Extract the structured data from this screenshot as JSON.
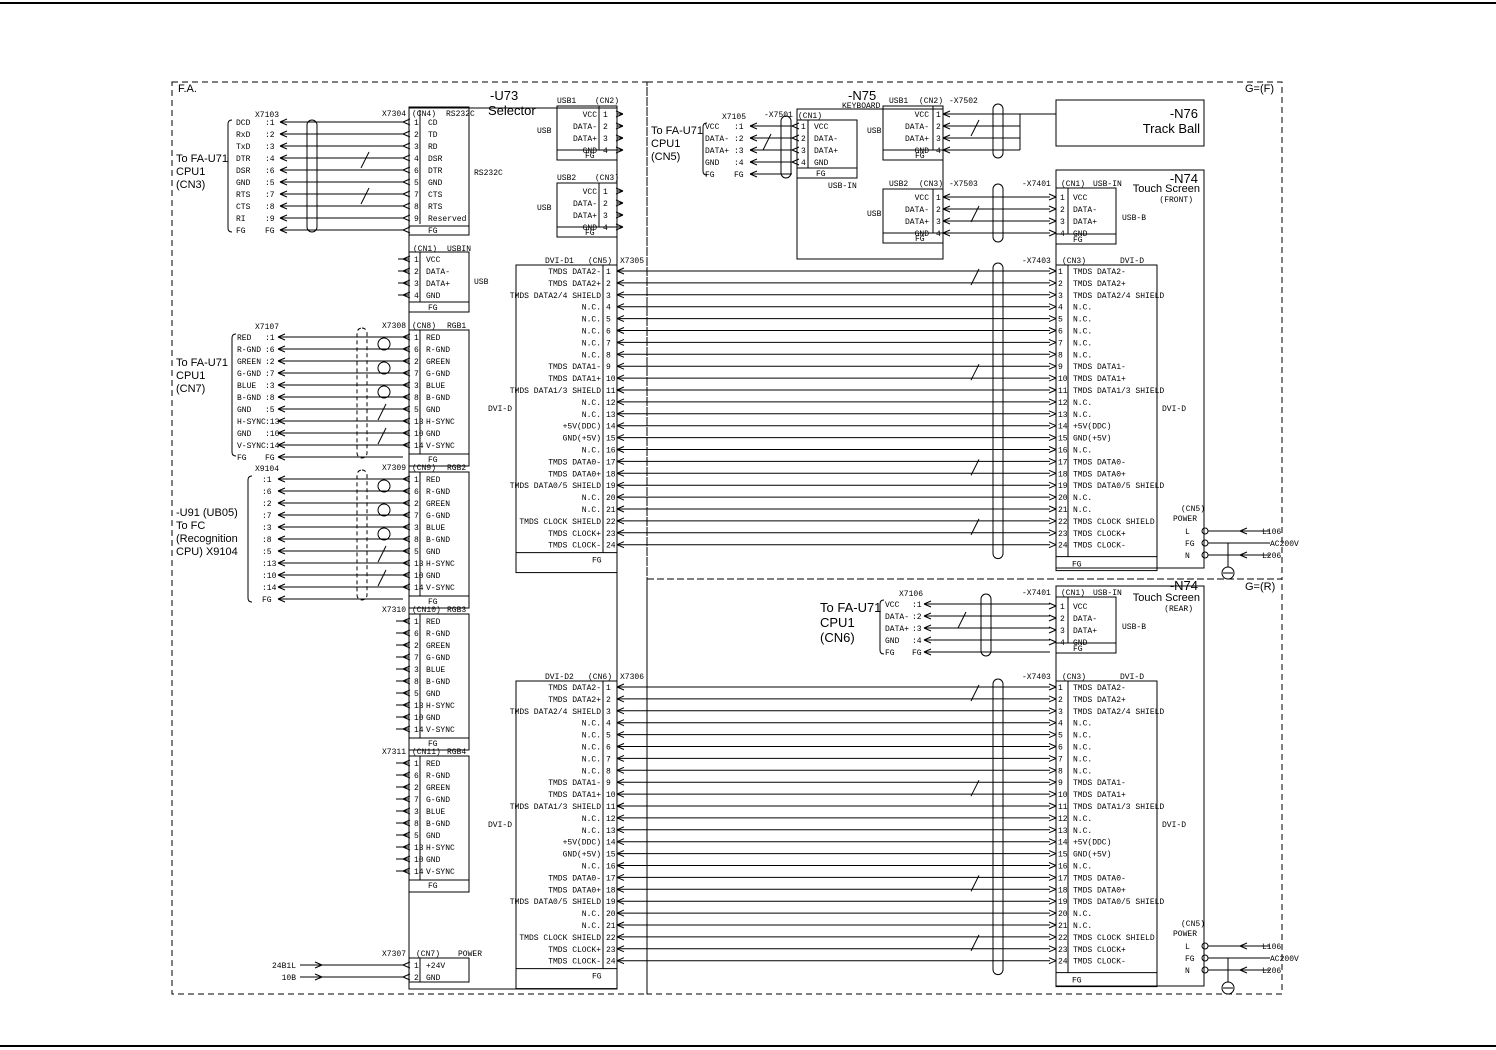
{
  "frames": {
    "fa_label": "F.A.",
    "g_f_label": "G=(F)",
    "g_r_label": "G=(R)"
  },
  "selector": {
    "ref": "-U73",
    "name": "Selector"
  },
  "keyboard": {
    "ref": "-N75",
    "name": "KEYBOARD",
    "usb_in": "USB-IN"
  },
  "trackball": {
    "ref": "-N76",
    "name": "Track Ball"
  },
  "touch_front": {
    "ref": "-N74",
    "name": "Touch Screen",
    "sub": "(FRONT)"
  },
  "touch_rear": {
    "ref": "-N74",
    "name": "Touch Screen",
    "sub": "(REAR)"
  },
  "rs232": {
    "source": [
      "To FA-U71",
      "CPU1",
      "(CN3)"
    ],
    "x_left": "X7103",
    "x_right": "X7304",
    "cn": "(CN4)",
    "cn_type": "RS232C",
    "side_label": "RS232C",
    "left_pins": [
      {
        "sig": "DCD",
        "n": ":1"
      },
      {
        "sig": "RxD",
        "n": ":2"
      },
      {
        "sig": "TxD",
        "n": ":3"
      },
      {
        "sig": "DTR",
        "n": ":4"
      },
      {
        "sig": "DSR",
        "n": ":6"
      },
      {
        "sig": "GND",
        "n": ":5"
      },
      {
        "sig": "RTS",
        "n": ":7"
      },
      {
        "sig": "CTS",
        "n": ":8"
      },
      {
        "sig": "RI",
        "n": ":9"
      },
      {
        "sig": "FG",
        "n": "FG"
      }
    ],
    "right_pins": [
      {
        "n": "1",
        "sig": "CD"
      },
      {
        "n": "2",
        "sig": "TD"
      },
      {
        "n": "3",
        "sig": "RD"
      },
      {
        "n": "4",
        "sig": "DSR"
      },
      {
        "n": "6",
        "sig": "DTR"
      },
      {
        "n": "5",
        "sig": "GND"
      },
      {
        "n": "7",
        "sig": "CTS"
      },
      {
        "n": "8",
        "sig": "RTS"
      },
      {
        "n": "9",
        "sig": "Reserved"
      }
    ],
    "fg": "FG"
  },
  "usb1": {
    "title": "USB1",
    "cn": "(CN2)",
    "side": "USB",
    "pins": [
      {
        "sig": "VCC",
        "n": "1"
      },
      {
        "sig": "DATA-",
        "n": "2"
      },
      {
        "sig": "DATA+",
        "n": "3"
      },
      {
        "sig": "GND",
        "n": "4"
      }
    ],
    "fg": "FG"
  },
  "usb2": {
    "title": "USB2",
    "cn": "(CN3)",
    "side": "USB",
    "pins": [
      {
        "sig": "VCC",
        "n": "1"
      },
      {
        "sig": "DATA-",
        "n": "2"
      },
      {
        "sig": "DATA+",
        "n": "3"
      },
      {
        "sig": "GND",
        "n": "4"
      }
    ],
    "fg": "FG"
  },
  "usbin": {
    "cn": "(CN1)",
    "title": "USBIN",
    "side": "USB",
    "pins": [
      {
        "n": "1",
        "sig": "VCC"
      },
      {
        "n": "2",
        "sig": "DATA-"
      },
      {
        "n": "3",
        "sig": "DATA+"
      },
      {
        "n": "4",
        "sig": "GND"
      }
    ],
    "fg": "FG"
  },
  "rgb1": {
    "source": [
      "To FA-U71",
      "CPU1",
      "(CN7)"
    ],
    "x_left": "X7107",
    "x_right": "X7308",
    "cn": "(CN8)",
    "title": "RGB1",
    "left_pins": [
      {
        "sig": "RED",
        "n": ":1"
      },
      {
        "sig": "R-GND",
        "n": ":6"
      },
      {
        "sig": "GREEN",
        "n": ":2"
      },
      {
        "sig": "G-GND",
        "n": ":7"
      },
      {
        "sig": "BLUE",
        "n": ":3"
      },
      {
        "sig": "B-GND",
        "n": ":8"
      },
      {
        "sig": "GND",
        "n": ":5"
      },
      {
        "sig": "H-SYNC",
        "n": ":13"
      },
      {
        "sig": "GND",
        "n": ":10"
      },
      {
        "sig": "V-SYNC",
        "n": ":14"
      },
      {
        "sig": "FG",
        "n": "FG"
      }
    ],
    "fg": "FG"
  },
  "rgb2": {
    "source": [
      "-U91 (UB05)",
      "To FC",
      "(Recognition",
      "CPU) X9104"
    ],
    "x_left": "X9104",
    "x_right": "X7309",
    "cn": "(CN9)",
    "title": "RGB2",
    "left_pins": [
      ":1",
      ":6",
      ":2",
      ":7",
      ":3",
      ":8",
      ":5",
      ":13",
      ":10",
      ":14",
      "FG"
    ],
    "fg": "FG"
  },
  "rgb3": {
    "x_right": "X7310",
    "cn": "(CN10)",
    "title": "RGB3",
    "fg": "FG"
  },
  "rgb4": {
    "x_right": "X7311",
    "cn": "(CN11)",
    "title": "RGB4",
    "fg": "FG"
  },
  "rgb_pins": [
    {
      "n": "1",
      "sig": "RED"
    },
    {
      "n": "6",
      "sig": "R-GND"
    },
    {
      "n": "2",
      "sig": "GREEN"
    },
    {
      "n": "7",
      "sig": "G-GND"
    },
    {
      "n": "3",
      "sig": "BLUE"
    },
    {
      "n": "8",
      "sig": "B-GND"
    },
    {
      "n": "5",
      "sig": "GND"
    },
    {
      "n": "13",
      "sig": "H-SYNC"
    },
    {
      "n": "10",
      "sig": "GND"
    },
    {
      "n": "14",
      "sig": "V-SYNC"
    }
  ],
  "power": {
    "x_right": "X7307",
    "cn": "(CN7)",
    "title": "POWER",
    "inputs": [
      "24B1L",
      "10B"
    ],
    "pins": [
      {
        "n": "1",
        "sig": "+24V"
      },
      {
        "n": "2",
        "sig": "GND"
      }
    ]
  },
  "dvi1": {
    "title": "DVI-D1",
    "cn": "(CN5)",
    "x": "X7305",
    "side": "DVI-D",
    "fg": "FG"
  },
  "dvi2": {
    "title": "DVI-D2",
    "cn": "(CN6)",
    "x": "X7306",
    "side": "DVI-D",
    "fg": "FG"
  },
  "dvi_pins": [
    "TMDS DATA2-",
    "TMDS DATA2+",
    "TMDS DATA2/4 SHIELD",
    "N.C.",
    "N.C.",
    "N.C.",
    "N.C.",
    "N.C.",
    "TMDS DATA1-",
    "TMDS DATA1+",
    "TMDS DATA1/3 SHIELD",
    "N.C.",
    "N.C.",
    "+5V(DDC)",
    "GND(+5V)",
    "N.C.",
    "TMDS DATA0-",
    "TMDS DATA0+",
    "TMDS DATA0/5 SHIELD",
    "N.C.",
    "N.C.",
    "TMDS CLOCK SHIELD",
    "TMDS CLOCK+",
    "TMDS CLOCK-"
  ],
  "kb": {
    "source": [
      "To FA-U71",
      "CPU1",
      "(CN5)"
    ],
    "x_left": "X7105",
    "x_right": "-X7501",
    "cn": "(CN1)",
    "left_pins": [
      {
        "sig": "VCC",
        "n": ":1"
      },
      {
        "sig": "DATA-",
        "n": ":2"
      },
      {
        "sig": "DATA+",
        "n": ":3"
      },
      {
        "sig": "GND",
        "n": ":4"
      },
      {
        "sig": "FG",
        "n": "FG"
      }
    ],
    "pins": [
      {
        "n": "1",
        "sig": "VCC"
      },
      {
        "n": "2",
        "sig": "DATA-"
      },
      {
        "n": "3",
        "sig": "DATA+"
      },
      {
        "n": "4",
        "sig": "GND"
      }
    ],
    "fg": "FG"
  },
  "kb_usb1": {
    "title": "USB1",
    "cn": "(CN2)",
    "x": "-X7502",
    "side": "USB",
    "pins": [
      {
        "sig": "VCC",
        "n": "1"
      },
      {
        "sig": "DATA-",
        "n": "2"
      },
      {
        "sig": "DATA+",
        "n": "3"
      },
      {
        "sig": "GND",
        "n": "4"
      }
    ],
    "fg": "FG"
  },
  "kb_usb2": {
    "title": "USB2",
    "cn": "(CN3)",
    "x": "-X7503",
    "side": "USB",
    "pins": [
      {
        "sig": "VCC",
        "n": "1"
      },
      {
        "sig": "DATA-",
        "n": "2"
      },
      {
        "sig": "DATA+",
        "n": "3"
      },
      {
        "sig": "GND",
        "n": "4"
      }
    ],
    "fg": "FG"
  },
  "ts_front_usb": {
    "x": "-X7401",
    "cn": "(CN1)",
    "title": "USB-IN",
    "side": "USB-B",
    "pins": [
      {
        "n": "1",
        "sig": "VCC"
      },
      {
        "n": "2",
        "sig": "DATA-"
      },
      {
        "n": "3",
        "sig": "DATA+"
      },
      {
        "n": "4",
        "sig": "GND"
      }
    ],
    "fg": "FG"
  },
  "ts_front_dvi": {
    "x": "-X7403",
    "cn": "(CN3)",
    "title": "DVI-D",
    "side": "DVI-D",
    "fg": "FG"
  },
  "ts_rear_usb": {
    "x": "-X7401",
    "cn": "(CN1)",
    "title": "USB-IN",
    "side": "USB-B",
    "source": [
      "To FA-U71",
      "CPU1",
      "(CN6)"
    ],
    "x_left": "X7106",
    "left_pins": [
      {
        "sig": "VCC",
        "n": ":1"
      },
      {
        "sig": "DATA-",
        "n": ":2"
      },
      {
        "sig": "DATA+",
        "n": ":3"
      },
      {
        "sig": "GND",
        "n": ":4"
      },
      {
        "sig": "FG",
        "n": "FG"
      }
    ],
    "pins": [
      {
        "n": "1",
        "sig": "VCC"
      },
      {
        "n": "2",
        "sig": "DATA-"
      },
      {
        "n": "3",
        "sig": "DATA+"
      },
      {
        "n": "4",
        "sig": "GND"
      }
    ],
    "fg": "FG"
  },
  "ts_rear_dvi": {
    "x": "-X7403",
    "cn": "(CN3)",
    "title": "DVI-D",
    "side": "DVI-D",
    "fg": "FG"
  },
  "ts_dvi_pins": [
    "TMDS DATA2-",
    "TMDS DATA2+",
    "TMDS DATA2/4 SHIELD",
    "N.C.",
    "N.C.",
    "N.C.",
    "N.C.",
    "N.C.",
    "TMDS DATA1-",
    "TMDS DATA1+",
    "TMDS DATA1/3 SHIELD",
    "N.C.",
    "N.C.",
    "+5V(DDC)",
    "GND(+5V)",
    "N.C.",
    "TMDS DATA0-",
    "TMDS DATA0+",
    "TMDS DATA0/5 SHIELD",
    "N.C.",
    "N.C.",
    "TMDS CLOCK SHIELD",
    "TMDS CLOCK+",
    "TMDS CLOCK-"
  ],
  "ts_power": {
    "cn": "(CN5)",
    "title": "POWER",
    "pins": [
      "L",
      "FG",
      "N"
    ],
    "inputs": [
      "L106",
      "AC200V",
      "L206"
    ]
  }
}
